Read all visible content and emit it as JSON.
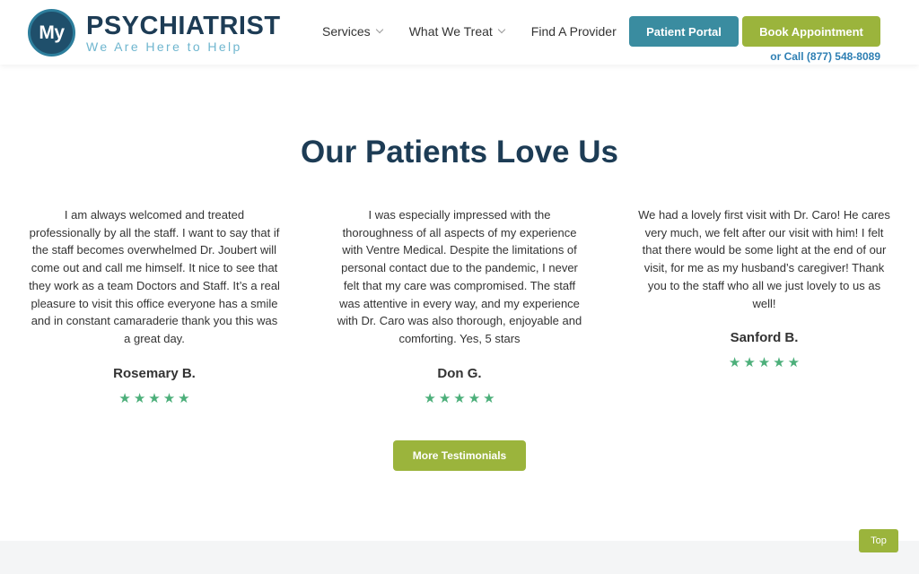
{
  "header": {
    "logo_mark": "My",
    "logo_title": "PSYCHIATRIST",
    "logo_tagline": "We Are Here to Help",
    "nav": [
      {
        "label": "Services",
        "has_dropdown": true
      },
      {
        "label": "What We Treat",
        "has_dropdown": true
      },
      {
        "label": "Find A Provider",
        "has_dropdown": false
      }
    ],
    "patient_portal_label": "Patient Portal",
    "book_label": "Book Appointment",
    "call_text": "or Call (877) 548-8089"
  },
  "section": {
    "title": "Our Patients Love Us"
  },
  "testimonials": [
    {
      "text": "I am always welcomed and treated professionally by all the staff. I want to say that if the staff becomes overwhelmed Dr. Joubert will come out and call me himself. It nice to see that they work as a team Doctors and Staff. It’s a real pleasure to visit this office everyone has a smile and in constant camaraderie thank you this was a great day.",
      "name": "Rosemary B.",
      "stars": 5
    },
    {
      "text": "I was especially impressed with the thoroughness of all aspects of my experience with Ventre Medical. Despite the limitations of personal contact due to the pandemic, I never felt that my care was compromised. The staff was attentive in every way, and my experience with Dr. Caro was also thorough, enjoyable and comforting. Yes, 5 stars",
      "name": "Don G.",
      "stars": 5
    },
    {
      "text": "We had a lovely first visit with Dr. Caro! He cares very much, we felt after our visit with him! I felt that there would be some light at the end of our visit, for me as my husband’s caregiver! Thank you to the staff who all we just lovely to us as well!",
      "name": "Sanford B.",
      "stars": 5
    }
  ],
  "more_button_label": "More Testimonials",
  "top_button_label": "Top",
  "colors": {
    "brand_navy": "#1d3c55",
    "portal_teal": "#3a8ca0",
    "accent_green": "#9bb43c",
    "star_green": "#4caf7a",
    "call_blue": "#2e7fb3"
  }
}
